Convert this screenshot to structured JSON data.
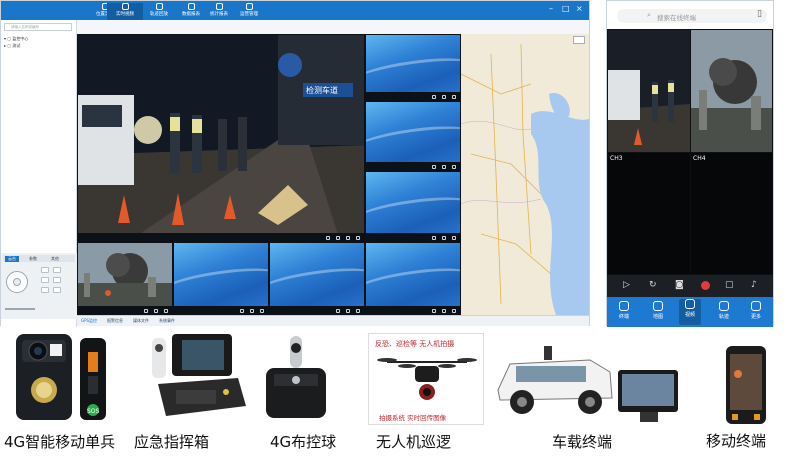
{
  "desktop": {
    "nav_tabs": [
      {
        "label": "位置定位",
        "active": false
      },
      {
        "label": "实时视频",
        "active": true
      },
      {
        "label": "轨迹回放",
        "active": false
      },
      {
        "label": "数据报表",
        "active": false
      },
      {
        "label": "统计报表",
        "active": false
      },
      {
        "label": "运营管理",
        "active": false
      }
    ],
    "search_placeholder": "请输入名称或编号",
    "tree": [
      {
        "label": "监控中心"
      },
      {
        "label": "测试"
      }
    ],
    "ptz_tabs": [
      "云台",
      "参数",
      "其他"
    ],
    "bottom_tabs": [
      "GPS监控",
      "报警信息",
      "媒体文件",
      "系统事件"
    ],
    "main_video": {
      "sign_text": "检测车道"
    },
    "window_controls": [
      "最小化",
      "最大化",
      "关闭"
    ]
  },
  "phone": {
    "search_placeholder": "搜索在线终端",
    "channels": [
      {
        "label": "CH3"
      },
      {
        "label": "CH4"
      }
    ],
    "bottom_nav": [
      {
        "label": "终端",
        "active": false
      },
      {
        "label": "地图",
        "active": false
      },
      {
        "label": "视频",
        "active": true
      },
      {
        "label": "轨迹",
        "active": false
      },
      {
        "label": "更多",
        "active": false
      }
    ]
  },
  "products": [
    {
      "caption": "4G智能移动单兵",
      "image": "body-camera"
    },
    {
      "caption": "应急指挥箱",
      "image": "command-case"
    },
    {
      "caption": "4G布控球",
      "image": "ptz-ball"
    },
    {
      "caption": "无人机巡逻",
      "image": "drone"
    },
    {
      "caption": "车载终端",
      "image": "vehicle-monitor"
    },
    {
      "caption": "移动终端",
      "image": "rugged-phone"
    }
  ],
  "drone_banner": {
    "top_text": "反恐、巡检等 无人机拍摄",
    "bottom_text": "拍摄系统 实时回传图像"
  },
  "colors": {
    "accent": "#1976c8",
    "active": "#135ea3"
  }
}
